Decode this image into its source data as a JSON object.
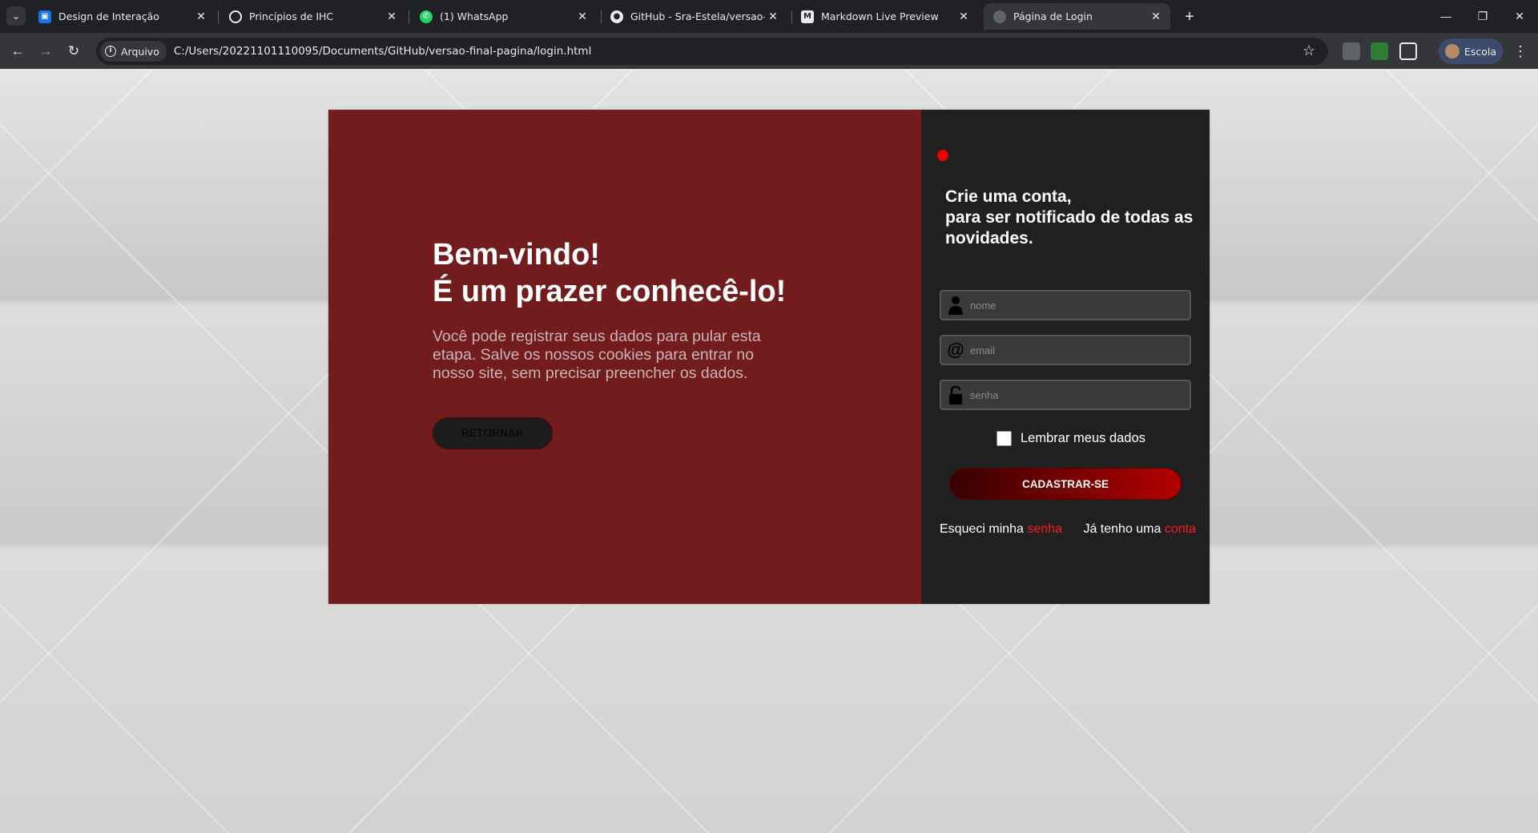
{
  "browser": {
    "tabs": [
      {
        "title": "Design de Interação",
        "icon": "classroom-icon"
      },
      {
        "title": "Princípios de IHC",
        "icon": "globe-icon"
      },
      {
        "title": "(1) WhatsApp",
        "icon": "whatsapp-icon"
      },
      {
        "title": "GitHub - Sra-Estela/versao-final",
        "icon": "github-icon"
      },
      {
        "title": "Markdown Live Preview",
        "icon": "markdown-icon"
      },
      {
        "title": "Página de Login",
        "icon": "globe-icon",
        "active": true
      }
    ],
    "address": {
      "chip_label": "Arquivo",
      "url": "C:/Users/20221101110095/Documents/GitHub/versao-final-pagina/login.html"
    },
    "profile_label": "Escola"
  },
  "page": {
    "left": {
      "heading_line1": "Bem-vindo!",
      "heading_line2": "É um prazer conhecê-lo!",
      "description": "Você pode registrar seus dados para pular esta etapa. Salve os nossos cookies para entrar no nosso site, sem precisar preencher os dados.",
      "return_button": "RETORNAR"
    },
    "right": {
      "title_line1": "Crie uma conta,",
      "title_line2": "para ser notificado de todas as novidades.",
      "fields": {
        "name_placeholder": "nome",
        "email_placeholder": "email",
        "password_placeholder": "senha"
      },
      "remember_label": "Lembrar meus dados",
      "signup_button": "CADASTRAR-SE",
      "forgot_text": "Esqueci minha ",
      "forgot_link": "senha",
      "account_text": "Já tenho uma ",
      "account_link": "conta"
    }
  },
  "colors": {
    "left_panel": "#721c1e",
    "right_panel": "#202020",
    "accent_red": "#ff1a1a",
    "status_dot": "#f00000"
  }
}
